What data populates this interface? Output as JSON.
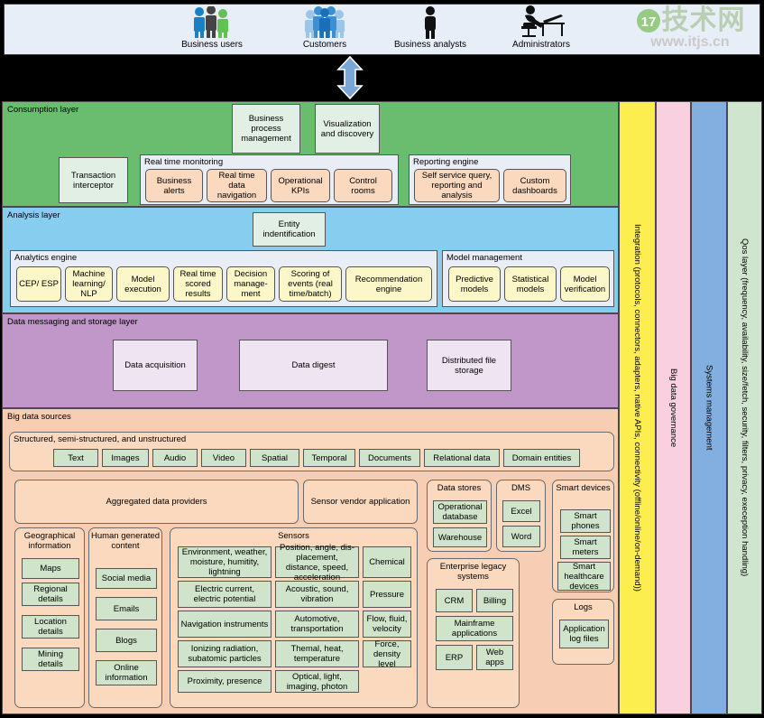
{
  "actors": [
    {
      "label": "Business users",
      "icon": "people-group-icon"
    },
    {
      "label": "Customers",
      "icon": "customers-group-icon"
    },
    {
      "label": "Business analysts",
      "icon": "person-icon"
    },
    {
      "label": "Administrators",
      "icon": "person-at-desk-icon"
    }
  ],
  "watermark": {
    "cn": "技术网",
    "url": "www.itjs.cn",
    "badge": "17"
  },
  "arrow": {
    "icon": "double-headed-vertical-arrow-icon"
  },
  "consumption": {
    "title": "Consumption layer",
    "top_boxes": [
      {
        "label": "Business process management"
      },
      {
        "label": "Visualization and discovery"
      }
    ],
    "transaction_interceptor": "Transaction interceptor",
    "real_time_monitoring": {
      "title": "Real time monitoring",
      "items": [
        "Business alerts",
        "Real time data navigation",
        "Operational KPIs",
        "Control rooms"
      ]
    },
    "reporting_engine": {
      "title": "Reporting engine",
      "items": [
        "Self service query, reporting and analysis",
        "Custom dashboards"
      ]
    }
  },
  "analysis": {
    "title": "Analysis layer",
    "entity_identification": "Entity indentification",
    "analytics_engine": {
      "title": "Analytics engine",
      "items": [
        "CEP/ ESP",
        "Machine learning/ NLP",
        "Model execution",
        "Real time scored results",
        "Decision manage-ment",
        "Scoring of events (real time/batch)",
        "Recommendation engine"
      ]
    },
    "model_management": {
      "title": "Model management",
      "items": [
        "Predictive models",
        "Statistical models",
        "Model verification"
      ]
    }
  },
  "storage": {
    "title": "Data messaging and storage layer",
    "items": [
      "Data acquisition",
      "Data digest",
      "Distributed file storage"
    ]
  },
  "sources": {
    "title": "Big data sources",
    "structured": {
      "title": "Structured, semi-structured, and unstructured",
      "items": [
        "Text",
        "Images",
        "Audio",
        "Video",
        "Spatial",
        "Temporal",
        "Documents",
        "Relational data",
        "Domain entities"
      ]
    },
    "aggregated_data_providers": "Aggregated data providers",
    "sensor_vendor_application": "Sensor vendor application",
    "geographical": {
      "title": "Geographical information",
      "items": [
        "Maps",
        "Regional details",
        "Location details",
        "Mining details"
      ]
    },
    "human_generated": {
      "title": "Human generated content",
      "items": [
        "Social media",
        "Emails",
        "Blogs",
        "Online information"
      ]
    },
    "sensors": {
      "title": "Sensors",
      "col1": [
        "Environment, weather, moisture, humitity, lightning",
        "Electric current, electric potential",
        "Navigation instruments",
        "Ionizing radiation, subatomic particles",
        "Proximity, presence"
      ],
      "col2": [
        "Position, angle, dis-placement, distance, speed, acceleration",
        "Acoustic, sound, vibration",
        "Automotive, transportation",
        "Themal, heat, temperature",
        "Optical, light, imaging, photon"
      ],
      "col3": [
        "Chemical",
        "Pressure",
        "Flow, fluid, velocity",
        "Force, density level"
      ]
    },
    "data_stores": {
      "title": "Data stores",
      "items": [
        "Operational database",
        "Warehouse"
      ]
    },
    "dms": {
      "title": "DMS",
      "items": [
        "Excel",
        "Word"
      ]
    },
    "smart_devices": {
      "title": "Smart devices",
      "items": [
        "Smart phones",
        "Smart meters",
        "Smart healthcare devices"
      ]
    },
    "enterprise_legacy": {
      "title": "Enterprise legacy systems",
      "items": [
        "CRM",
        "Billing",
        "Mainframe applications",
        "ERP",
        "Web apps"
      ]
    },
    "logs": {
      "title": "Logs",
      "items": [
        "Application log files"
      ]
    }
  },
  "vertical_bands": [
    {
      "label": "Integration (protocols, connectors, adapters, native APIs, connectivity (offline/online/on-demand))",
      "color": "#fcee4f"
    },
    {
      "label": "Big data governance",
      "color": "#f9d0e0"
    },
    {
      "label": "Systems management",
      "color": "#82aee0"
    },
    {
      "label": "Qos layer (frequency, availability, size/fetch, security, filters, privacy, exeception handling)",
      "color": "#cfe5cd"
    }
  ]
}
